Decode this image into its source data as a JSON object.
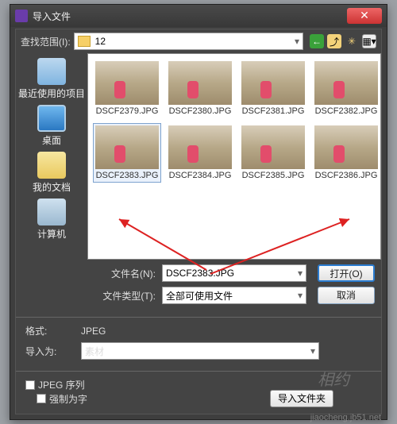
{
  "title": "导入文件",
  "lookIn": {
    "label": "查找范围(I):",
    "value": "12"
  },
  "sidebar": {
    "items": [
      {
        "label": "最近使用的项目"
      },
      {
        "label": "桌面"
      },
      {
        "label": "我的文档"
      },
      {
        "label": "计算机"
      }
    ]
  },
  "files": [
    {
      "name": "DSCF2379.JPG"
    },
    {
      "name": "DSCF2380.JPG"
    },
    {
      "name": "DSCF2381.JPG"
    },
    {
      "name": "DSCF2382.JPG"
    },
    {
      "name": "DSCF2383.JPG"
    },
    {
      "name": "DSCF2384.JPG"
    },
    {
      "name": "DSCF2385.JPG"
    },
    {
      "name": "DSCF2386.JPG"
    }
  ],
  "selectedFile": "DSCF2383.JPG",
  "filename": {
    "label": "文件名(N):",
    "value": "DSCF2383.JPG"
  },
  "filetype": {
    "label": "文件类型(T):",
    "value": "全部可使用文件"
  },
  "buttons": {
    "open": "打开(O)",
    "cancel": "取消",
    "importFolder": "导入文件夹"
  },
  "format": {
    "label": "格式:",
    "value": "JPEG"
  },
  "importAs": {
    "label": "导入为:",
    "value": "素材"
  },
  "seq": {
    "label": "JPEG 序列"
  },
  "force": {
    "label": "强制为字"
  },
  "watermark": "相约",
  "siteWm": "jiaocheng.jb51.net"
}
